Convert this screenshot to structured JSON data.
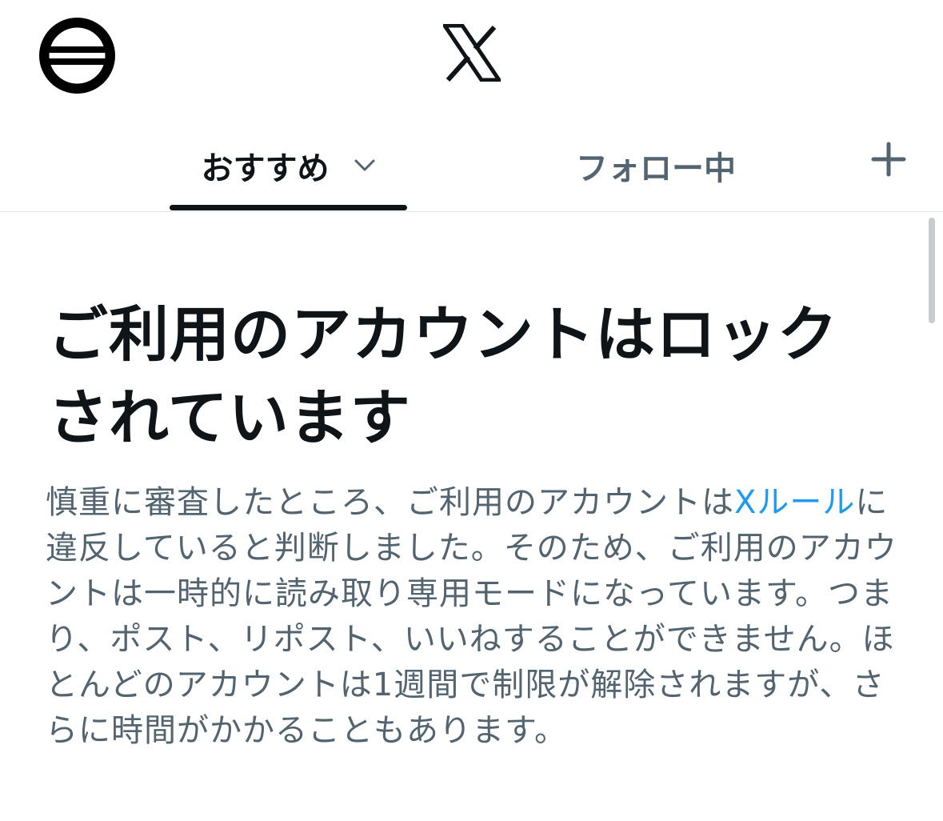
{
  "header": {
    "avatar_icon": "profile-avatar-icon",
    "logo_icon": "x-logo-icon"
  },
  "tabs": [
    {
      "label": "おすすめ",
      "active": true,
      "icon": "chevron-down-icon"
    },
    {
      "label": "フォロー中",
      "active": false
    }
  ],
  "add_tab_icon": "plus-icon",
  "notice": {
    "title_line1": "ご利用のアカウントはロック",
    "title_line2": "されています",
    "body_before_link": "慎重に審査したところ、ご利用のアカウントは",
    "link_text": "Xルール",
    "body_after_link": "に違反していると判断しました。そのため、ご利用のアカウントは一時的に読み取り専用モードになっています。つまり、ポスト、リポスト、いいねすることができません。ほとんどのアカウントは1週間で制限が解除されますが、さらに時間がかかることもあります。"
  },
  "colors": {
    "text_primary": "#0f1419",
    "text_secondary": "#536471",
    "link": "#1d9bf0",
    "divider": "#e1e6ea"
  }
}
